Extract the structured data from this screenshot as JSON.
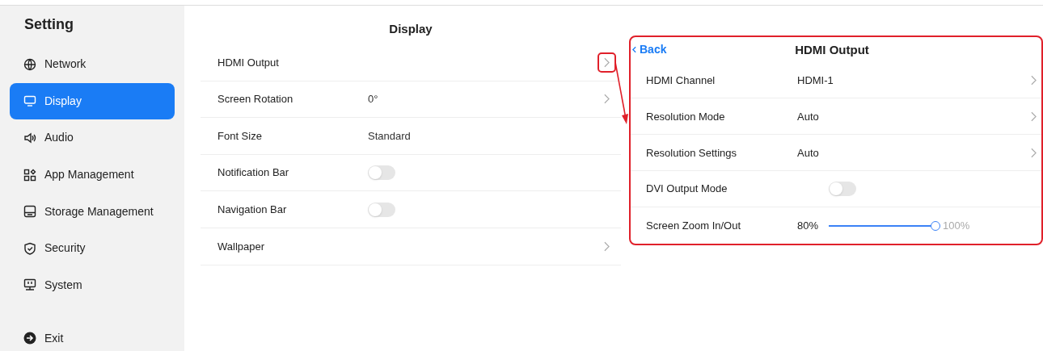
{
  "sidebar": {
    "title": "Setting",
    "items": [
      {
        "label": "Network",
        "kind": "globe",
        "selected": false
      },
      {
        "label": "Display",
        "kind": "monitor",
        "selected": true
      },
      {
        "label": "Audio",
        "kind": "speaker",
        "selected": false
      },
      {
        "label": "App Management",
        "kind": "apps",
        "selected": false
      },
      {
        "label": "Storage Management",
        "kind": "storage",
        "selected": false
      },
      {
        "label": "Security",
        "kind": "shield",
        "selected": false
      },
      {
        "label": "System",
        "kind": "system",
        "selected": false
      }
    ],
    "exit": "Exit"
  },
  "display_panel": {
    "title": "Display",
    "rows": [
      {
        "label": "HDMI Output",
        "kind": "link",
        "highlighted": true
      },
      {
        "label": "Screen Rotation",
        "value": "0°",
        "kind": "link",
        "highlighted": false
      },
      {
        "label": "Font Size",
        "value": "Standard",
        "kind": "text",
        "highlighted": false
      },
      {
        "label": "Notification Bar",
        "kind": "toggle",
        "on": false,
        "highlighted": false
      },
      {
        "label": "Navigation Bar",
        "kind": "toggle",
        "on": false,
        "highlighted": false
      },
      {
        "label": "Wallpaper",
        "kind": "link",
        "highlighted": false
      }
    ]
  },
  "hdmi_panel": {
    "back": "Back",
    "title": "HDMI Output",
    "rows": [
      {
        "label": "HDMI Channel",
        "value": "HDMI-1",
        "kind": "link"
      },
      {
        "label": "Resolution Mode",
        "value": "Auto",
        "kind": "link"
      },
      {
        "label": "Resolution Settings",
        "value": "Auto",
        "kind": "link"
      },
      {
        "label": "DVI Output Mode",
        "kind": "toggle",
        "on": false
      },
      {
        "label": "Screen Zoom In/Out",
        "kind": "slider",
        "min_label": "80%",
        "max_label": "100%",
        "level": 1
      }
    ]
  }
}
